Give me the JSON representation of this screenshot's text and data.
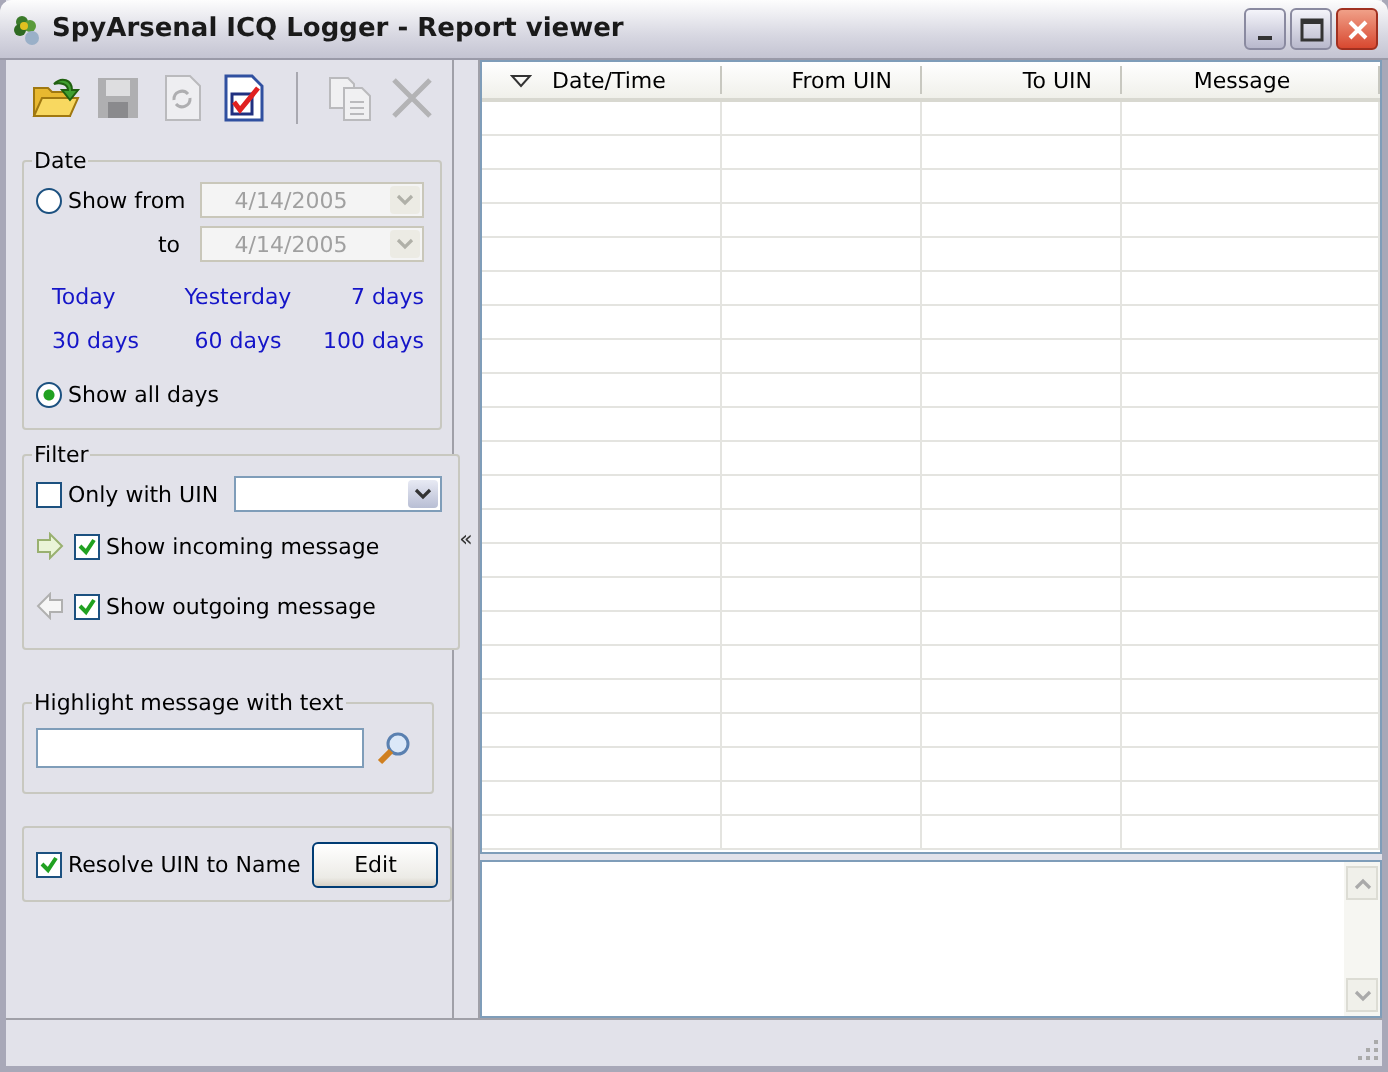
{
  "window": {
    "title": "SpyArsenal ICQ Logger - Report viewer"
  },
  "toolbar": [
    {
      "kind": "open",
      "disabled": false
    },
    {
      "kind": "save",
      "disabled": true
    },
    {
      "kind": "refresh",
      "disabled": true
    },
    {
      "kind": "report",
      "disabled": false
    },
    {
      "kind": "separator"
    },
    {
      "kind": "copy",
      "disabled": true
    },
    {
      "kind": "delete",
      "disabled": true
    }
  ],
  "date": {
    "title": "Date",
    "show_from": {
      "label": "Show from",
      "selected": false,
      "value": "4/14/2005",
      "disabled": true
    },
    "to": {
      "label": "to",
      "value": "4/14/2005",
      "disabled": true
    },
    "quick_links": [
      "Today",
      "Yesterday",
      "7 days",
      "30 days",
      "60 days",
      "100 days"
    ],
    "show_all": {
      "label": "Show all days",
      "selected": true
    }
  },
  "filter": {
    "title": "Filter",
    "only_with_uin": {
      "label": "Only with UIN",
      "checked": false
    },
    "incoming": {
      "label": "Show incoming message",
      "checked": true
    },
    "outgoing": {
      "label": "Show outgoing message",
      "checked": true
    }
  },
  "highlight": {
    "title": "Highlight message with text"
  },
  "resolve": {
    "label": "Resolve UIN to Name",
    "checked": true
  },
  "edit_button": "Edit",
  "splitter": "«",
  "table": {
    "columns": [
      "Date/Time",
      "From UIN",
      "To UIN",
      "Message"
    ]
  }
}
